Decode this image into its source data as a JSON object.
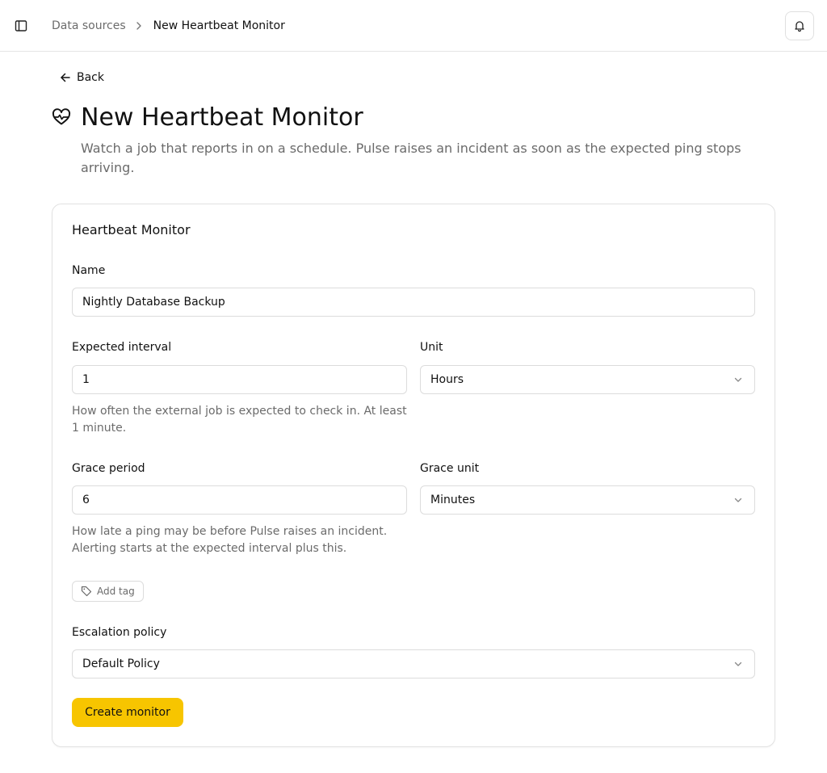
{
  "breadcrumb": {
    "parent": "Data sources",
    "current": "New Heartbeat Monitor"
  },
  "back_label": "Back",
  "page": {
    "title": "New Heartbeat Monitor",
    "subtitle": "Watch a job that reports in on a schedule. Pulse raises an incident as soon as the expected ping stops arriving."
  },
  "form": {
    "card_title": "Heartbeat Monitor",
    "name_label": "Name",
    "name_value": "Nightly Database Backup",
    "interval_label": "Expected interval",
    "interval_value": "1",
    "unit_label": "Unit",
    "unit_value": "Hours",
    "interval_hint": "How often the external job is expected to check in. At least 1 minute.",
    "grace_label": "Grace period",
    "grace_value": "6",
    "grace_unit_label": "Grace unit",
    "grace_unit_value": "Minutes",
    "grace_hint": "How late a ping may be before Pulse raises an incident. Alerting starts at the expected interval plus this.",
    "add_tag_label": "Add tag",
    "escalation_label": "Escalation policy",
    "escalation_value": "Default Policy",
    "submit_label": "Create monitor"
  },
  "icons": {
    "sidebar_toggle": "sidebar-icon",
    "breadcrumb_separator": "chevron-right-icon",
    "notifications": "bell-icon",
    "back": "arrow-left-icon",
    "page": "heart-pulse-icon",
    "tag": "tag-icon",
    "select": "chevron-down-icon"
  },
  "colors": {
    "accent": "#f7c500",
    "muted_text": "#6b6b6b",
    "border": "#dcdcdc"
  }
}
